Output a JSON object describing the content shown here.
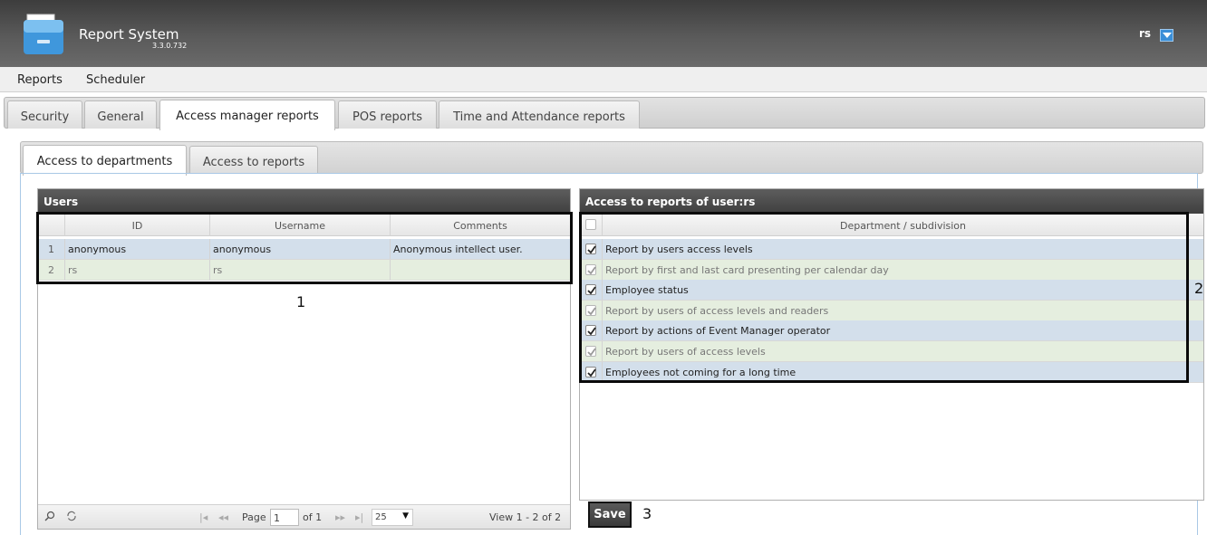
{
  "header": {
    "app_title": "Report System",
    "version": "3.3.0.732",
    "user": "rs"
  },
  "menu": {
    "items": [
      "Reports",
      "Scheduler"
    ]
  },
  "main_tabs": [
    "Security",
    "General",
    "Access manager reports",
    "POS reports",
    "Time and Attendance reports"
  ],
  "main_tabs_active": "Access manager reports",
  "sub_tabs": [
    "Access to departments",
    "Access to reports"
  ],
  "sub_tabs_active": "Access to departments",
  "users_panel": {
    "caption": "Users",
    "columns": [
      "ID",
      "Username",
      "Comments"
    ],
    "rows": [
      {
        "num": "1",
        "id": "anonymous",
        "username": "anonymous",
        "comments": "Anonymous intellect user."
      },
      {
        "num": "2",
        "id": "rs",
        "username": "rs",
        "comments": ""
      }
    ],
    "pager": {
      "page_label": "Page",
      "page_value": "1",
      "of_label": "of 1",
      "rows_per_page": "25",
      "view_text": "View 1 - 2 of 2"
    }
  },
  "access_panel": {
    "caption": "Access to reports of user:rs",
    "column": "Department / subdivision",
    "rows": [
      {
        "label": "Report by users access levels",
        "checked": true,
        "enabled": true
      },
      {
        "label": "Report by first and last card presenting per calendar day",
        "checked": true,
        "enabled": false
      },
      {
        "label": "Employee status",
        "checked": true,
        "enabled": true
      },
      {
        "label": "Report by users of access levels and readers",
        "checked": true,
        "enabled": false
      },
      {
        "label": "Report by actions of Event Manager operator",
        "checked": true,
        "enabled": true
      },
      {
        "label": "Report by users of access levels",
        "checked": true,
        "enabled": false
      },
      {
        "label": "Employees not coming for a long time",
        "checked": true,
        "enabled": true
      }
    ]
  },
  "save_label": "Save",
  "annotations": [
    "1",
    "2",
    "3"
  ],
  "colors": {
    "row_selected": "#d3dfeb",
    "row_alt": "#e5eedf",
    "header_dark": "#3f3f3f",
    "accent": "#3b8fd8"
  }
}
